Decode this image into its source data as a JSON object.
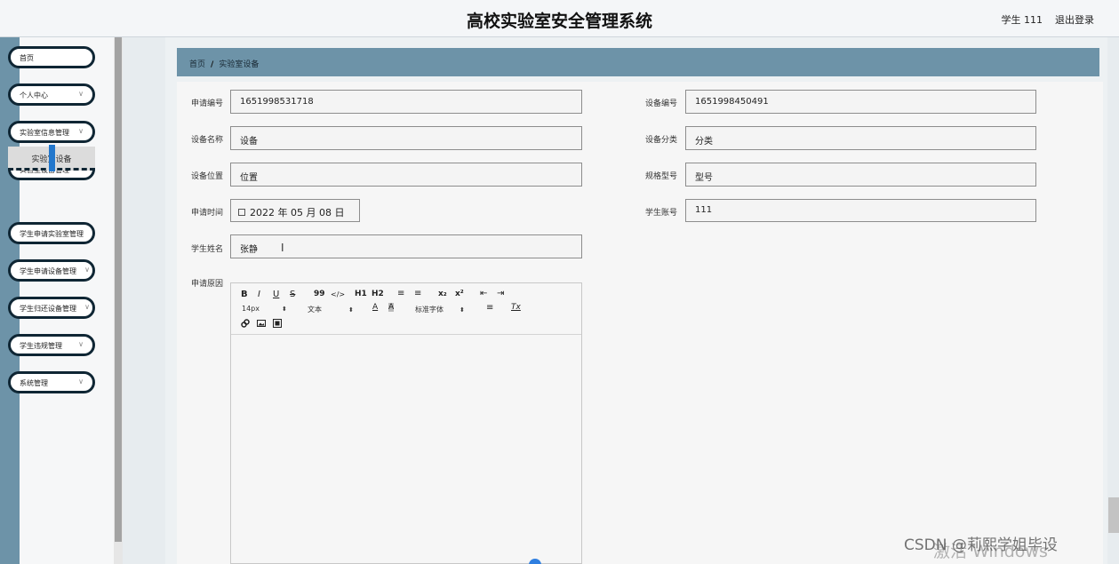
{
  "header": {
    "title": "高校实验室安全管理系统",
    "user": "学生 111",
    "logout": "退出登录"
  },
  "sidebar": {
    "items": [
      {
        "label": "首页",
        "has_chevron": false
      },
      {
        "label": "个人中心",
        "has_chevron": true
      },
      {
        "label": "实验室信息管理",
        "has_chevron": true
      },
      {
        "label": "实验室设备管理",
        "has_chevron": true
      },
      {
        "label": "学生申请实验室管理",
        "has_chevron": true
      },
      {
        "label": "学生申请设备管理",
        "has_chevron": true
      },
      {
        "label": "学生归还设备管理",
        "has_chevron": true
      },
      {
        "label": "学生违规管理",
        "has_chevron": true
      },
      {
        "label": "系统管理",
        "has_chevron": true
      }
    ],
    "submenu": {
      "label": "实验室设备"
    }
  },
  "breadcrumb": {
    "home": "首页",
    "separator": "/",
    "current": "实验室设备"
  },
  "form": {
    "apply_no": {
      "label": "申请编号",
      "value": "1651998531718"
    },
    "device_no": {
      "label": "设备编号",
      "value": "1651998450491"
    },
    "device_name": {
      "label": "设备名称",
      "value": "设备"
    },
    "device_category": {
      "label": "设备分类",
      "value": "分类"
    },
    "device_location": {
      "label": "设备位置",
      "value": "位置"
    },
    "spec_model": {
      "label": "规格型号",
      "value": "型号"
    },
    "apply_time": {
      "label": "申请时间",
      "value": "2022 年 05 月 08 日"
    },
    "student_account": {
      "label": "学生账号",
      "value": "111"
    },
    "student_name": {
      "label": "学生姓名",
      "value": "张静"
    },
    "apply_reason": {
      "label": "申请原因",
      "value": ""
    }
  },
  "editor_toolbar": {
    "bold": "B",
    "italic": "I",
    "underline": "U",
    "strike": "S",
    "quote": "99",
    "code": "</>",
    "h1": "H1",
    "h2": "H2",
    "ordered_list": "≡",
    "bullet_list": "≡",
    "subscript": "x₂",
    "superscript": "x²",
    "indent_decrease": "⇤",
    "indent_increase": "⇥",
    "font_size": "14px",
    "text_style": "文本",
    "font_color": "A",
    "background_color": "A",
    "font_family": "标准字体",
    "align": "≡",
    "clear_format": "Tx"
  },
  "overlay": {
    "watermark": "激活 Windows",
    "csdn": "CSDN @莉熙学姐毕设"
  }
}
